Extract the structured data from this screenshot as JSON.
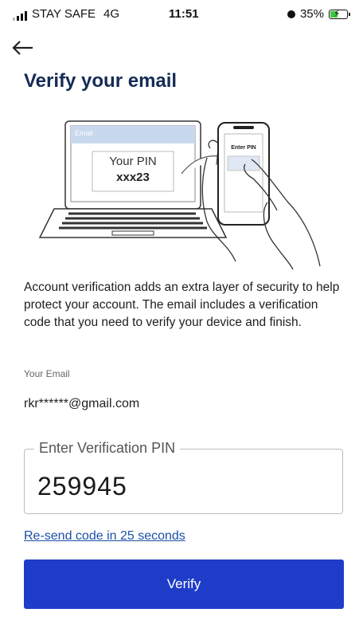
{
  "status_bar": {
    "carrier": "STAY SAFE",
    "network": "4G",
    "time": "11:51",
    "battery": "35%",
    "battery_color": "#3cc73c"
  },
  "header": {
    "back_icon": "back-arrow-icon",
    "title": "Verify your email"
  },
  "illustration": {
    "laptop_header": "Email",
    "laptop_pin_label": "Your PIN",
    "laptop_pin_value": "xxx23",
    "phone_label": "Enter PIN"
  },
  "description": "Account verification adds an extra layer of security to help protect your account. The email includes a verification code that you need to verify your device and finish.",
  "email": {
    "label": "Your Email",
    "value": "rkr******@gmail.com"
  },
  "pin": {
    "label": "Enter Verification PIN",
    "value": "259945"
  },
  "resend_text": "Re-send code in 25 seconds",
  "verify_button": "Verify",
  "colors": {
    "title": "#142b55",
    "primary_button": "#1e3cc8",
    "link": "#1b4fa8"
  }
}
